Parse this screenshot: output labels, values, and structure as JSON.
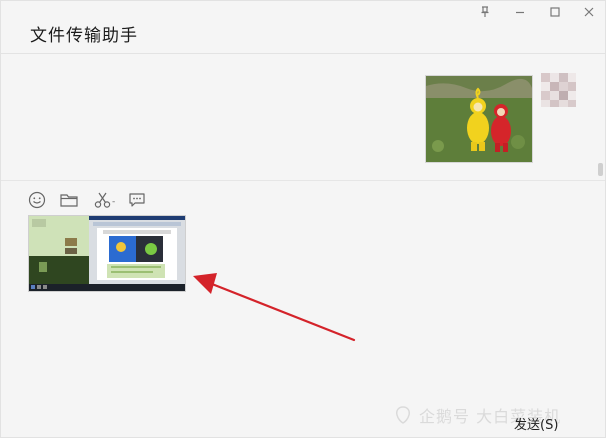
{
  "window": {
    "title": "文件传输助手",
    "controls": [
      "pin-icon",
      "minimize-icon",
      "maximize-icon",
      "close-icon"
    ]
  },
  "chat": {
    "messages": [
      {
        "type": "image",
        "sender": "self",
        "content": "teletubbies-photo"
      }
    ]
  },
  "toolbar": {
    "items": [
      "emoji-icon",
      "folder-icon",
      "scissors-icon",
      "chat-bubble-icon"
    ],
    "screenshot_dropdown": "-"
  },
  "input": {
    "pasted_image": "desktop-screenshot"
  },
  "footer": {
    "send_label": "发送(S)"
  },
  "watermark": {
    "text": "企鹅号 大白菜装机"
  },
  "colors": {
    "background": "#f5f5f5",
    "arrow": "#d4232a"
  }
}
